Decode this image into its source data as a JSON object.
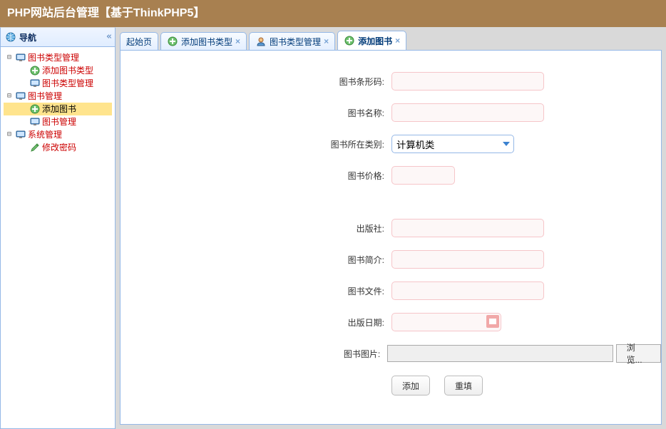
{
  "header": {
    "title": "PHP网站后台管理【基于ThinkPHP5】"
  },
  "sidebar": {
    "title": "导航",
    "groups": [
      {
        "label": "图书类型管理",
        "children": [
          {
            "label": "添加图书类型",
            "icon": "plus"
          },
          {
            "label": "图书类型管理",
            "icon": "screen"
          }
        ]
      },
      {
        "label": "图书管理",
        "children": [
          {
            "label": "添加图书",
            "icon": "plus",
            "selected": true
          },
          {
            "label": "图书管理",
            "icon": "screen"
          }
        ]
      },
      {
        "label": "系统管理",
        "children": [
          {
            "label": "修改密码",
            "icon": "pencil"
          }
        ]
      }
    ]
  },
  "tabs": [
    {
      "label": "起始页",
      "icon": null,
      "closable": false
    },
    {
      "label": "添加图书类型",
      "icon": "plus",
      "closable": true
    },
    {
      "label": "图书类型管理",
      "icon": "user",
      "closable": true
    },
    {
      "label": "添加图书",
      "icon": "plus",
      "closable": true,
      "active": true
    }
  ],
  "form": {
    "fields": {
      "barcode": "图书条形码:",
      "name": "图书名称:",
      "category": "图书所在类别:",
      "price": "图书价格:",
      "publisher": "出版社:",
      "intro": "图书简介:",
      "file": "图书文件:",
      "pubdate": "出版日期:",
      "image": "图书图片:"
    },
    "category_value": "计算机类",
    "browse_label": "浏览...",
    "submit_label": "添加",
    "reset_label": "重填"
  }
}
